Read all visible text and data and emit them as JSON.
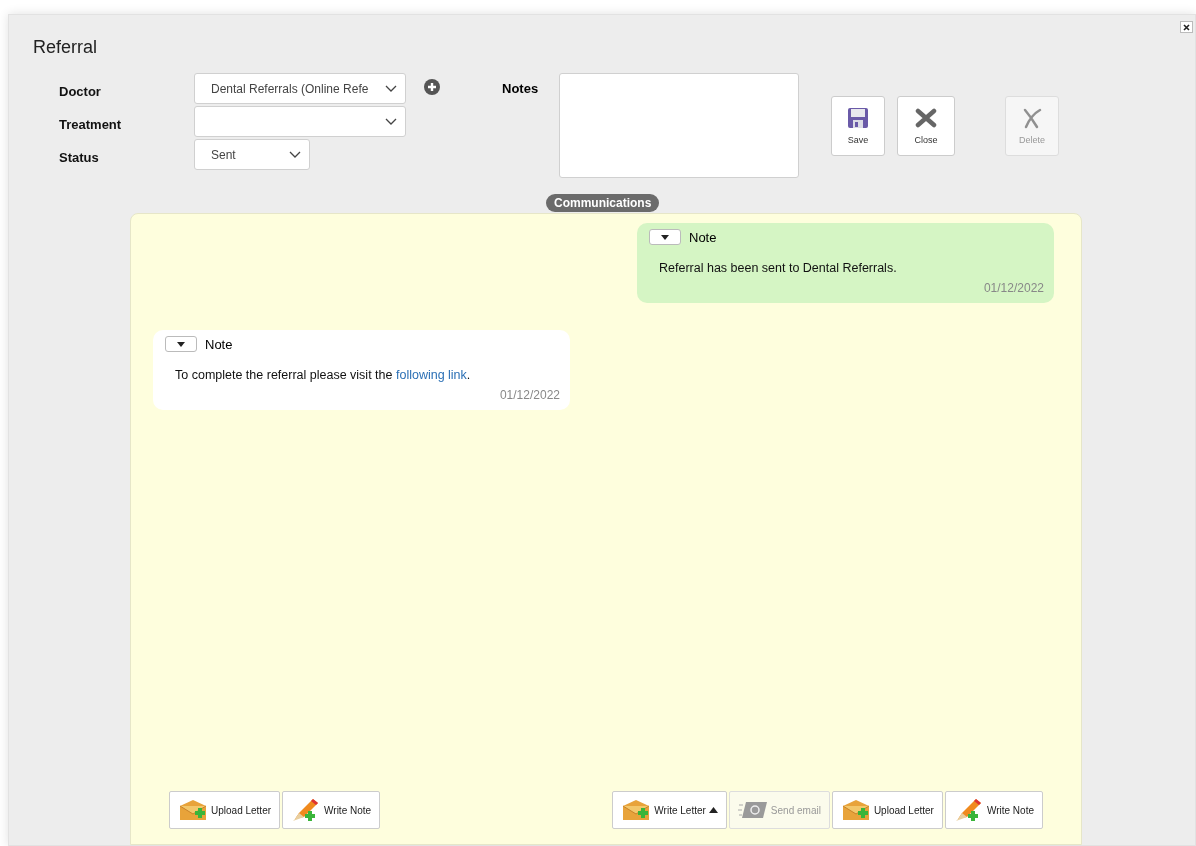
{
  "dialog": {
    "title": "Referral"
  },
  "form": {
    "fields": [
      {
        "label": "Doctor",
        "value": "Dental Referrals (Online Refe"
      },
      {
        "label": "Treatment"
      },
      {
        "label": "Status",
        "value": "Sent"
      }
    ],
    "notes_label": "Notes"
  },
  "actions": [
    {
      "label": "Save",
      "kind": "save",
      "disabled": false
    },
    {
      "label": "Close",
      "kind": "close",
      "disabled": false
    },
    {
      "label": "Delete",
      "kind": "delete",
      "disabled": true
    }
  ],
  "communications": {
    "title": "Communications",
    "messages": [
      {
        "kind": "outgoing",
        "type": "Note",
        "text": "Referral has been sent to Dental Referrals.",
        "date": "01/12/2022"
      },
      {
        "kind": "incoming",
        "type": "Note",
        "text": "To complete the referral please visit the",
        "link": "following link",
        "text_after": ".",
        "date": "01/12/2022"
      }
    ],
    "left_toolbar": [
      {
        "label": "Upload Letter",
        "kind": "upload",
        "disabled": false
      },
      {
        "label": "Write Note",
        "kind": "note",
        "disabled": false
      }
    ],
    "right_toolbar": [
      {
        "label": "Write Letter",
        "kind": "upload",
        "disabled": false,
        "menu": true
      },
      {
        "label": "Send email",
        "kind": "email",
        "disabled": true
      },
      {
        "label": "Upload Letter",
        "kind": "upload",
        "disabled": false
      },
      {
        "label": "Write Note",
        "kind": "note",
        "disabled": false
      }
    ]
  }
}
